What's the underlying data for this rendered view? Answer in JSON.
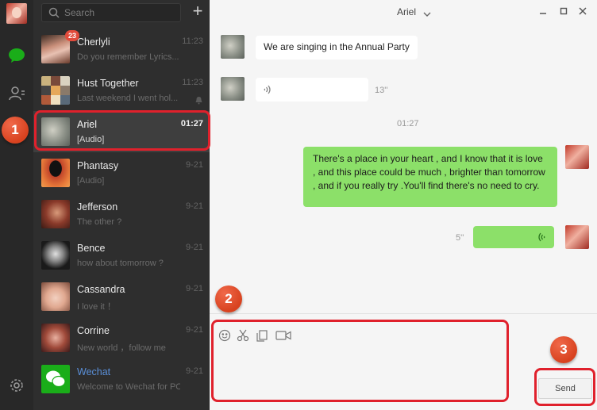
{
  "search": {
    "placeholder": "Search"
  },
  "conversations": [
    {
      "name": "Cherlyli",
      "message": "Do you remember Lyrics...",
      "time": "11:23",
      "badge": "23"
    },
    {
      "name": "Hust Together",
      "message": "Last weekend I went hol...",
      "time": "11:23",
      "muted": true
    },
    {
      "name": "Ariel",
      "message": "[Audio]",
      "time": "01:27",
      "active": true
    },
    {
      "name": "Phantasy",
      "message": "[Audio]",
      "time": "9-21"
    },
    {
      "name": "Jefferson",
      "message": "The other ?",
      "time": "9-21"
    },
    {
      "name": "Bence",
      "message": "how about tomorrow ?",
      "time": "9-21"
    },
    {
      "name": "Cassandra",
      "message": "I love it ！",
      "time": "9-21"
    },
    {
      "name": "Corrine",
      "message": "New  world ，follow me",
      "time": "9-21"
    },
    {
      "name": "Wechat",
      "message": "Welcome to Wechat for PC...",
      "time": "9-21"
    }
  ],
  "chat": {
    "title": "Ariel",
    "messages": [
      {
        "text": "We are singing in the Annual Party"
      },
      {
        "duration": "13''"
      },
      {
        "timestamp": "01:27"
      },
      {
        "text": "There's a place in your heart , and I know that it is love , and this place could be much , brighter than tomorrow , and if you really try .You'll find there's no need to cry."
      },
      {
        "duration": "5''"
      }
    ]
  },
  "send_label": "Send",
  "steps": [
    "1",
    "2",
    "3"
  ],
  "colors": {
    "highlight": "#e0212c",
    "sent_bubble": "#8ce069",
    "accent": "#1aad19",
    "step_badge": "#d8421f"
  },
  "icons": [
    "chat-icon",
    "contacts-icon",
    "settings-icon",
    "search-icon",
    "plus-icon",
    "minimize-icon",
    "maximize-icon",
    "close-icon",
    "emoji-icon",
    "scissors-icon",
    "file-icon",
    "video-call-icon",
    "audio-wave-icon",
    "mute-bell-icon",
    "chevron-down-icon"
  ]
}
